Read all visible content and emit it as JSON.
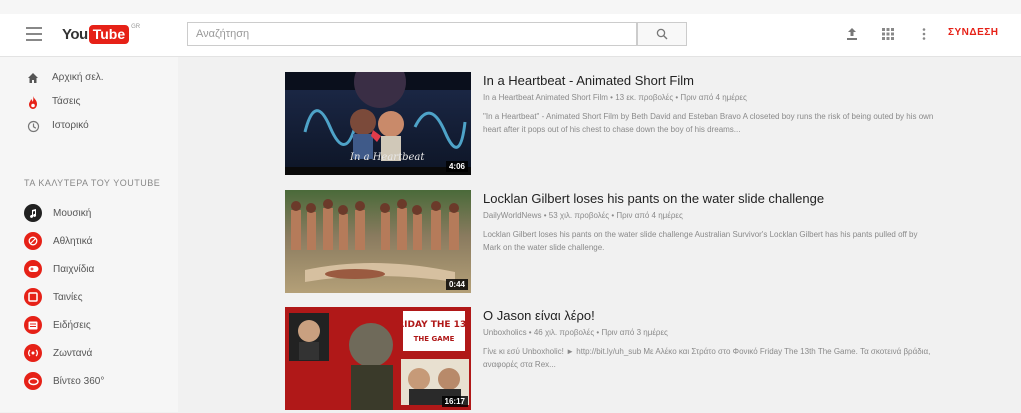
{
  "header": {
    "menu_icon": "hamburger-menu-icon",
    "logo_you": "You",
    "logo_tube": "Tube",
    "logo_country": "GR",
    "search_placeholder": "Αναζήτηση",
    "search_icon": "search-icon",
    "upload_icon": "upload-icon",
    "apps_icon": "apps-grid-icon",
    "more_icon": "more-vertical-icon",
    "signin_label": "ΣΥΝΔΕΣΗ"
  },
  "sidebar": {
    "nav": [
      {
        "label": "Αρχική σελ.",
        "icon": "home-icon"
      },
      {
        "label": "Τάσεις",
        "icon": "trending-flame-icon"
      },
      {
        "label": "Ιστορικό",
        "icon": "history-icon"
      }
    ],
    "section_title": "ΤΑ ΚΑΛΥΤΕΡΑ ΤΟΥ YOUTUBE",
    "subscriptions": [
      {
        "label": "Μουσική",
        "icon": "music-icon",
        "color": "#212121"
      },
      {
        "label": "Αθλητικά",
        "icon": "sports-icon",
        "color": "#e62117"
      },
      {
        "label": "Παιχνίδια",
        "icon": "gaming-icon",
        "color": "#e62117"
      },
      {
        "label": "Ταινίες",
        "icon": "movies-icon",
        "color": "#e62117"
      },
      {
        "label": "Ειδήσεις",
        "icon": "news-icon",
        "color": "#e62117"
      },
      {
        "label": "Ζωντανά",
        "icon": "live-icon",
        "color": "#e62117"
      },
      {
        "label": "Βίντεο 360°",
        "icon": "video-360-icon",
        "color": "#e62117"
      }
    ]
  },
  "videos": [
    {
      "title": "In a Heartbeat - Animated Short Film",
      "meta": "In a Heartbeat Animated Short Film • 13 εκ. προβολές • Πριν από 4 ημέρες",
      "description": "\"In a Heartbeat\" - Animated Short Film by Beth David and Esteban Bravo A closeted boy runs the risk of being outed by his own heart after it pops out of his chest to chase down the boy of his dreams...",
      "duration": "4:06"
    },
    {
      "title": "Locklan Gilbert loses his pants on the water slide challenge",
      "meta": "DailyWorldNews • 53 χιλ. προβολές • Πριν από 4 ημέρες",
      "description": "Locklan Gilbert loses his pants on the water slide challenge Australian Survivor's Locklan Gilbert has his pants pulled off by Mark on the water slide challenge.",
      "duration": "0:44"
    },
    {
      "title": "Ο Jason είναι λέρο!",
      "meta": "Unboxholics • 46 χιλ. προβολές • Πριν από 3 ημέρες",
      "description": "Γίνε κι εσύ Unboxholic! ► http://bit.ly/uh_sub Με Αλέκο και Στράτο στο Φονικό Friday The 13th The Game. Τα σκοτεινά βράδια, αναφορές στα Rex...",
      "duration": "16:17"
    }
  ],
  "colors": {
    "accent": "#e62117",
    "sidebar_bg": "#f6f6f6",
    "page_bg": "#f1f1f1"
  }
}
